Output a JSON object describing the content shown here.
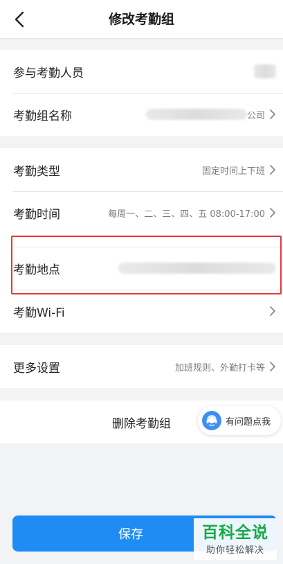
{
  "header": {
    "title": "修改考勤组",
    "back_icon": "chevron-left-icon"
  },
  "group1": {
    "members_label": "参与考勤人员",
    "name_label": "考勤组名称",
    "name_value_suffix": "公司"
  },
  "group2": {
    "type_label": "考勤类型",
    "type_value": "固定时间上下班",
    "time_label": "考勤时间",
    "time_value": "每周一、二、三、四、五 08:00-17:00",
    "location_label": "考勤地点",
    "wifi_label": "考勤Wi-Fi"
  },
  "group3": {
    "more_label": "更多设置",
    "more_value": "加班规则、外勤打卡等"
  },
  "delete_label": "删除考勤组",
  "help": {
    "label": "有问题点我",
    "icon": "customer-service-icon"
  },
  "save_label": "保存",
  "watermark": {
    "main": "百科全说",
    "sub": "助你轻松解决"
  },
  "colors": {
    "accent": "#1e8cf2",
    "highlight": "#e03a3a",
    "watermark": "#19a847"
  }
}
